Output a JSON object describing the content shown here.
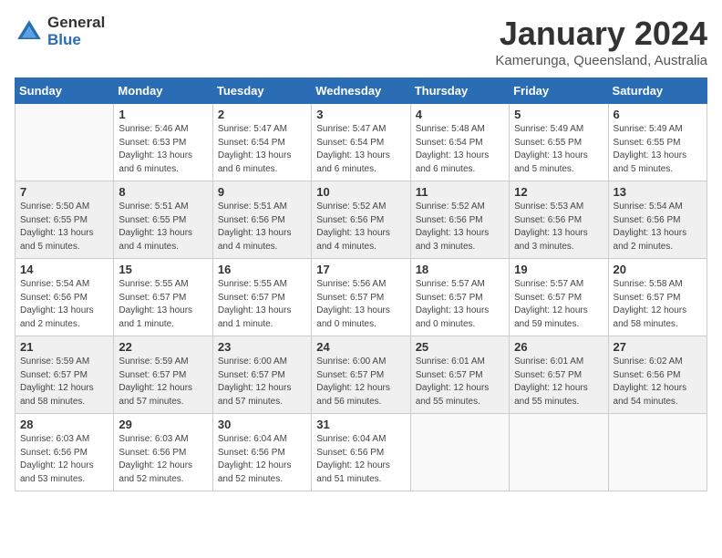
{
  "logo": {
    "general": "General",
    "blue": "Blue"
  },
  "title": {
    "month": "January 2024",
    "location": "Kamerunga, Queensland, Australia"
  },
  "weekdays": [
    "Sunday",
    "Monday",
    "Tuesday",
    "Wednesday",
    "Thursday",
    "Friday",
    "Saturday"
  ],
  "weeks": [
    [
      {
        "day": "",
        "info": ""
      },
      {
        "day": "1",
        "info": "Sunrise: 5:46 AM\nSunset: 6:53 PM\nDaylight: 13 hours\nand 6 minutes."
      },
      {
        "day": "2",
        "info": "Sunrise: 5:47 AM\nSunset: 6:54 PM\nDaylight: 13 hours\nand 6 minutes."
      },
      {
        "day": "3",
        "info": "Sunrise: 5:47 AM\nSunset: 6:54 PM\nDaylight: 13 hours\nand 6 minutes."
      },
      {
        "day": "4",
        "info": "Sunrise: 5:48 AM\nSunset: 6:54 PM\nDaylight: 13 hours\nand 6 minutes."
      },
      {
        "day": "5",
        "info": "Sunrise: 5:49 AM\nSunset: 6:55 PM\nDaylight: 13 hours\nand 5 minutes."
      },
      {
        "day": "6",
        "info": "Sunrise: 5:49 AM\nSunset: 6:55 PM\nDaylight: 13 hours\nand 5 minutes."
      }
    ],
    [
      {
        "day": "7",
        "info": "Sunrise: 5:50 AM\nSunset: 6:55 PM\nDaylight: 13 hours\nand 5 minutes."
      },
      {
        "day": "8",
        "info": "Sunrise: 5:51 AM\nSunset: 6:55 PM\nDaylight: 13 hours\nand 4 minutes."
      },
      {
        "day": "9",
        "info": "Sunrise: 5:51 AM\nSunset: 6:56 PM\nDaylight: 13 hours\nand 4 minutes."
      },
      {
        "day": "10",
        "info": "Sunrise: 5:52 AM\nSunset: 6:56 PM\nDaylight: 13 hours\nand 4 minutes."
      },
      {
        "day": "11",
        "info": "Sunrise: 5:52 AM\nSunset: 6:56 PM\nDaylight: 13 hours\nand 3 minutes."
      },
      {
        "day": "12",
        "info": "Sunrise: 5:53 AM\nSunset: 6:56 PM\nDaylight: 13 hours\nand 3 minutes."
      },
      {
        "day": "13",
        "info": "Sunrise: 5:54 AM\nSunset: 6:56 PM\nDaylight: 13 hours\nand 2 minutes."
      }
    ],
    [
      {
        "day": "14",
        "info": "Sunrise: 5:54 AM\nSunset: 6:56 PM\nDaylight: 13 hours\nand 2 minutes."
      },
      {
        "day": "15",
        "info": "Sunrise: 5:55 AM\nSunset: 6:57 PM\nDaylight: 13 hours\nand 1 minute."
      },
      {
        "day": "16",
        "info": "Sunrise: 5:55 AM\nSunset: 6:57 PM\nDaylight: 13 hours\nand 1 minute."
      },
      {
        "day": "17",
        "info": "Sunrise: 5:56 AM\nSunset: 6:57 PM\nDaylight: 13 hours\nand 0 minutes."
      },
      {
        "day": "18",
        "info": "Sunrise: 5:57 AM\nSunset: 6:57 PM\nDaylight: 13 hours\nand 0 minutes."
      },
      {
        "day": "19",
        "info": "Sunrise: 5:57 AM\nSunset: 6:57 PM\nDaylight: 12 hours\nand 59 minutes."
      },
      {
        "day": "20",
        "info": "Sunrise: 5:58 AM\nSunset: 6:57 PM\nDaylight: 12 hours\nand 58 minutes."
      }
    ],
    [
      {
        "day": "21",
        "info": "Sunrise: 5:59 AM\nSunset: 6:57 PM\nDaylight: 12 hours\nand 58 minutes."
      },
      {
        "day": "22",
        "info": "Sunrise: 5:59 AM\nSunset: 6:57 PM\nDaylight: 12 hours\nand 57 minutes."
      },
      {
        "day": "23",
        "info": "Sunrise: 6:00 AM\nSunset: 6:57 PM\nDaylight: 12 hours\nand 57 minutes."
      },
      {
        "day": "24",
        "info": "Sunrise: 6:00 AM\nSunset: 6:57 PM\nDaylight: 12 hours\nand 56 minutes."
      },
      {
        "day": "25",
        "info": "Sunrise: 6:01 AM\nSunset: 6:57 PM\nDaylight: 12 hours\nand 55 minutes."
      },
      {
        "day": "26",
        "info": "Sunrise: 6:01 AM\nSunset: 6:57 PM\nDaylight: 12 hours\nand 55 minutes."
      },
      {
        "day": "27",
        "info": "Sunrise: 6:02 AM\nSunset: 6:56 PM\nDaylight: 12 hours\nand 54 minutes."
      }
    ],
    [
      {
        "day": "28",
        "info": "Sunrise: 6:03 AM\nSunset: 6:56 PM\nDaylight: 12 hours\nand 53 minutes."
      },
      {
        "day": "29",
        "info": "Sunrise: 6:03 AM\nSunset: 6:56 PM\nDaylight: 12 hours\nand 52 minutes."
      },
      {
        "day": "30",
        "info": "Sunrise: 6:04 AM\nSunset: 6:56 PM\nDaylight: 12 hours\nand 52 minutes."
      },
      {
        "day": "31",
        "info": "Sunrise: 6:04 AM\nSunset: 6:56 PM\nDaylight: 12 hours\nand 51 minutes."
      },
      {
        "day": "",
        "info": ""
      },
      {
        "day": "",
        "info": ""
      },
      {
        "day": "",
        "info": ""
      }
    ]
  ]
}
